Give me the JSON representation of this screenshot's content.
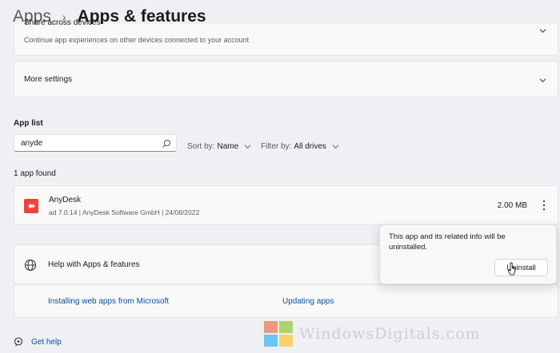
{
  "breadcrumb": {
    "root": "Apps",
    "separator": "›",
    "current": "Apps & features"
  },
  "share_card": {
    "title_partial": "Share across devices",
    "subtitle": "Continue app experiences on other devices connected to your account"
  },
  "more_settings": {
    "label": "More settings"
  },
  "app_list": {
    "label": "App list",
    "search_value": "anyde",
    "sort_label": "Sort by:",
    "sort_value": "Name",
    "filter_label": "Filter by:",
    "filter_value": "All drives",
    "found_text": "1 app found"
  },
  "app": {
    "name": "AnyDesk",
    "meta": "ad 7.0.14  |  AnyDesk Software GmbH  |  24/08/2022",
    "size": "2.00 MB",
    "logo_color": "#ef443b"
  },
  "popup": {
    "message": "This app and its related info will be uninstalled.",
    "button": "Uninstall"
  },
  "help": {
    "title": "Help with Apps & features",
    "links": [
      "Installing web apps from Microsoft",
      "Updating apps"
    ]
  },
  "get_help": "Get help",
  "watermark": "WindowsDigitals.com",
  "colors": {
    "link": "#0a4fa0",
    "background": "#eef0f3",
    "card": "#f9f9fa"
  }
}
